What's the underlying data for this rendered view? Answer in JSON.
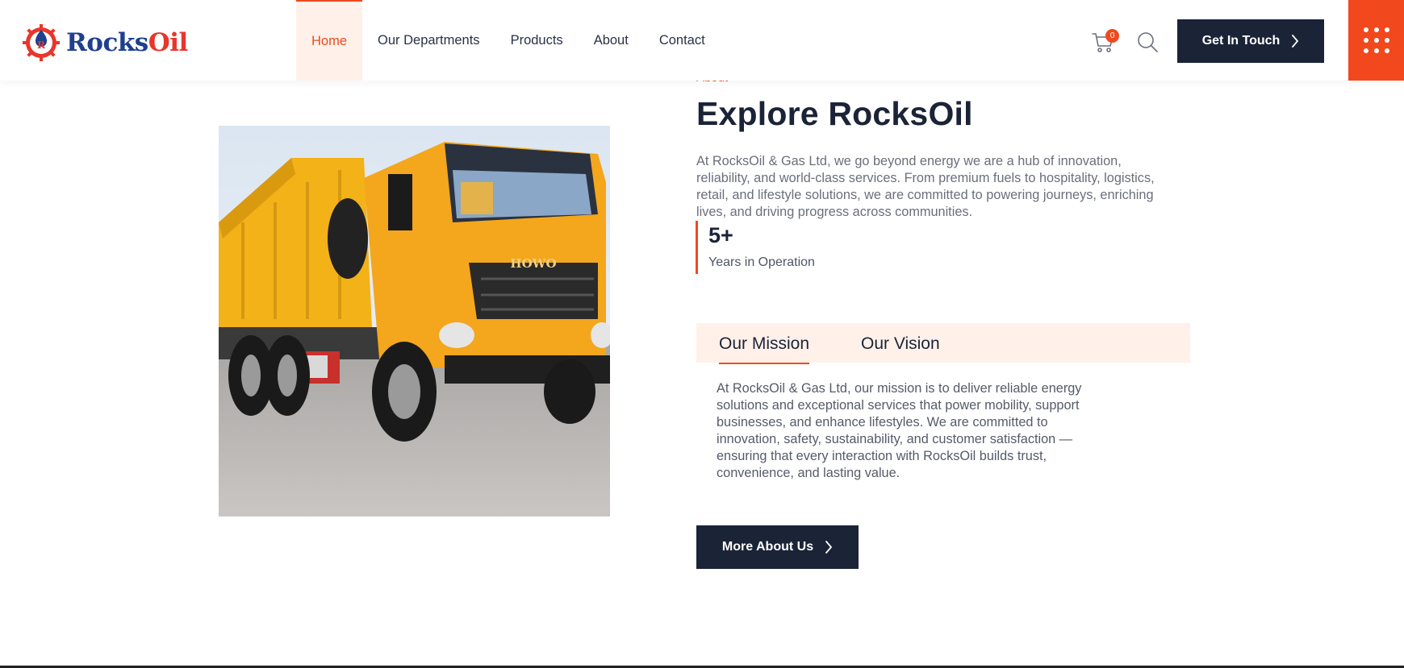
{
  "brand": {
    "name_part1": "Rocks",
    "name_part2": "Oil"
  },
  "nav": {
    "items": [
      {
        "label": "Home"
      },
      {
        "label": "Our Departments"
      },
      {
        "label": "Products"
      },
      {
        "label": "About"
      },
      {
        "label": "Contact"
      }
    ],
    "active": "Home"
  },
  "header": {
    "cart_count": "0",
    "cta_label": "Get In Touch"
  },
  "about": {
    "eyebrow": "About",
    "title": "Explore RocksOil",
    "intro": "At RocksOil & Gas Ltd, we go beyond energy we are a hub of innovation, reliability, and world-class services. From premium fuels to hospitality, logistics, retail, and lifestyle solutions, we are committed to powering journeys, enriching lives, and driving progress across communities.",
    "stat": {
      "value": "5+",
      "label": "Years in Operation"
    },
    "tabs": [
      {
        "label": "Our Mission"
      },
      {
        "label": "Our Vision"
      }
    ],
    "active_tab": "Our Mission",
    "mission": "At RocksOil & Gas Ltd, our mission is to deliver reliable energy solutions and exceptional services that power mobility, support businesses, and enhance lifestyles. We are committed to innovation, safety, sustainability, and customer satisfaction — ensuring that every interaction with RocksOil builds trust, convenience, and lasting value.",
    "button_label": "More About Us"
  },
  "colors": {
    "accent": "#f1491d",
    "navy": "#1b2337",
    "tab_bg": "#fff1ea",
    "brand_blue": "#1f3f8f",
    "brand_red": "#e8362c"
  },
  "icons": [
    "rocksoil-logo-icon",
    "cart-icon",
    "search-icon",
    "chevron-right-icon",
    "grid-menu-icon"
  ]
}
